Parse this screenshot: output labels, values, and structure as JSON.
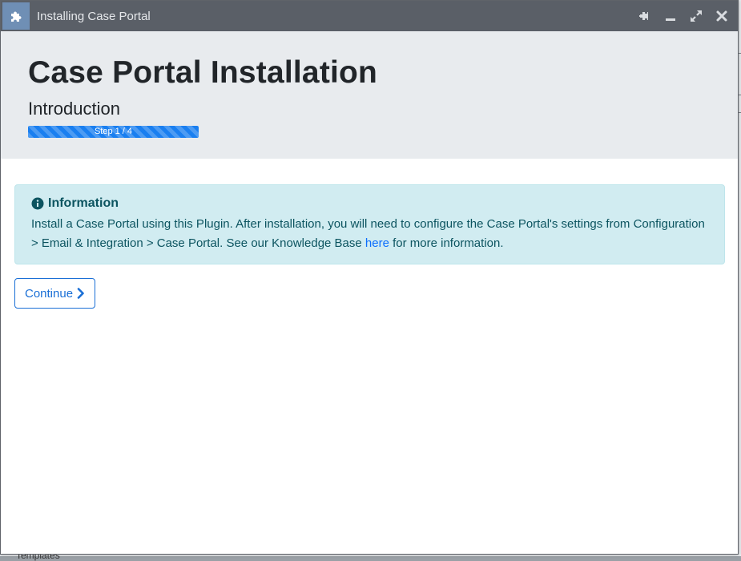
{
  "window": {
    "title": "Installing Case Portal",
    "icons": {
      "app": "puzzle-piece-icon",
      "pin": "pin-icon",
      "minimize": "minimize-icon",
      "maximize": "expand-icon",
      "close": "close-icon"
    }
  },
  "header": {
    "title": "Case Portal Installation",
    "subtitle": "Introduction",
    "progress": {
      "label": "Step 1 / 4",
      "fraction": 0.25
    }
  },
  "info_alert": {
    "icon": "info-circle-icon",
    "heading": "Information",
    "text_before_link": "Install a Case Portal using this Plugin. After installation, you will need to configure the Case Portal's settings from Configuration > Email & Integration > Case Portal. See our Knowledge Base ",
    "link_text": "here",
    "text_after_link": " for more information."
  },
  "actions": {
    "continue_label": "Continue",
    "continue_icon": "chevron-right-icon"
  },
  "background": {
    "partial_text": "Templates"
  },
  "colors": {
    "titlebar": "#5a5f67",
    "header_band": "#e8ebee",
    "progress": "#1a7ff0",
    "alert_bg": "#d1ecf1",
    "alert_text": "#0c5460",
    "link": "#0d6efd",
    "button_border": "#1a6fd6"
  }
}
